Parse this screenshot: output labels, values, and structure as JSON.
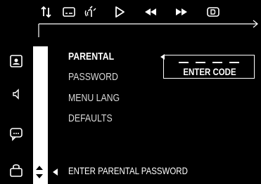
{
  "toolbar": {
    "icons": [
      "sort-arrows-icon",
      "subtitle-icon",
      "audio-icon",
      "play-icon",
      "rewind-icon",
      "fast-forward-icon",
      "display-icon"
    ]
  },
  "sidebar": {
    "icons": [
      "photo-icon",
      "speaker-icon",
      "chat-icon",
      "lock-icon"
    ]
  },
  "menu": {
    "items": [
      {
        "label": "PARENTAL",
        "active": true
      },
      {
        "label": "PASSWORD",
        "active": false
      },
      {
        "label": "MENU LANG",
        "active": false
      },
      {
        "label": "DEFAULTS",
        "active": false
      }
    ]
  },
  "code_entry": {
    "label": "ENTER CODE",
    "slots": 4
  },
  "status": {
    "text": "ENTER PARENTAL PASSWORD"
  },
  "colors": {
    "background": "#000000",
    "foreground": "#ffffff"
  }
}
